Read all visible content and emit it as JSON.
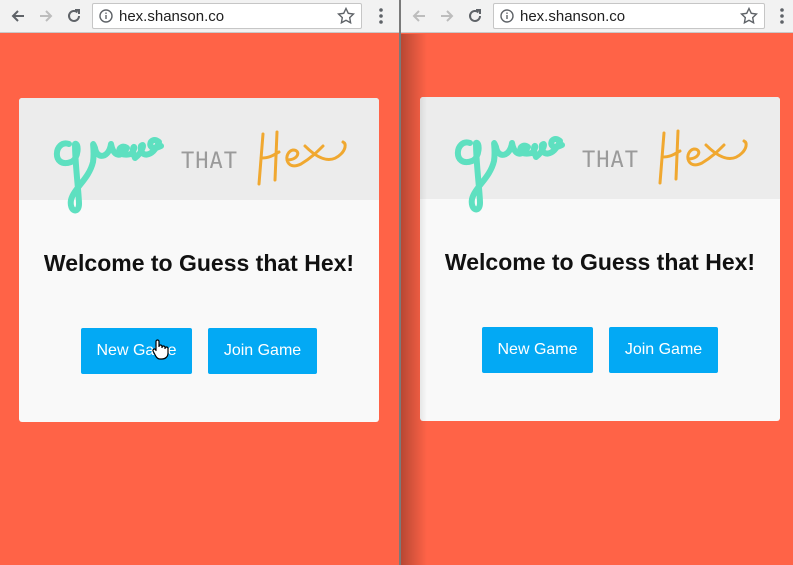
{
  "windows": [
    {
      "url": "hex.shanson.co",
      "card": {
        "logo": {
          "word1": "guess",
          "word2": "THAT",
          "word3": "Hex"
        },
        "title": "Welcome to Guess that Hex!",
        "new_game_label": "New Game",
        "join_game_label": "Join Game"
      }
    },
    {
      "url": "hex.shanson.co",
      "card": {
        "logo": {
          "word1": "guess",
          "word2": "THAT",
          "word3": "Hex"
        },
        "title": "Welcome to Guess that Hex!",
        "new_game_label": "New Game",
        "join_game_label": "Join Game"
      }
    }
  ],
  "colors": {
    "background": "#ff6347",
    "button": "#03a9f4",
    "logo_guess": "#5ee0c0",
    "logo_that": "#9a9a9a",
    "logo_hex": "#f0a830"
  },
  "icons": [
    "back-arrow-icon",
    "forward-arrow-icon",
    "reload-icon",
    "info-icon",
    "star-icon",
    "menu-dots-icon",
    "mouse-pointer-icon"
  ]
}
